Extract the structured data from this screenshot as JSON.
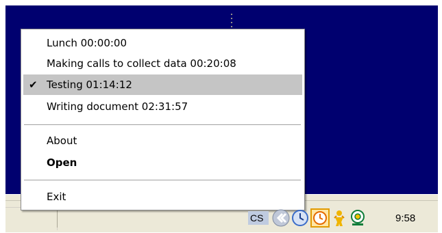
{
  "menu": {
    "tasks": [
      {
        "label": "Lunch  00:00:00",
        "checked": false
      },
      {
        "label": "Making calls to collect data  00:20:08",
        "checked": false
      },
      {
        "label": "Testing  01:14:12",
        "checked": true
      },
      {
        "label": "Writing document  02:31:57",
        "checked": false
      }
    ],
    "about": "About",
    "open": "Open",
    "exit": "Exit",
    "check_mark": "✔"
  },
  "tray": {
    "language": "CS",
    "clock": "9:58",
    "icons": [
      "show-hidden-icons",
      "clock-app-icon",
      "timer-icon",
      "messenger-icon",
      "network-icon"
    ]
  },
  "colors": {
    "desktop": "#00006f",
    "taskbar": "#ece9d8",
    "selected_item": "#c5c5c5"
  }
}
